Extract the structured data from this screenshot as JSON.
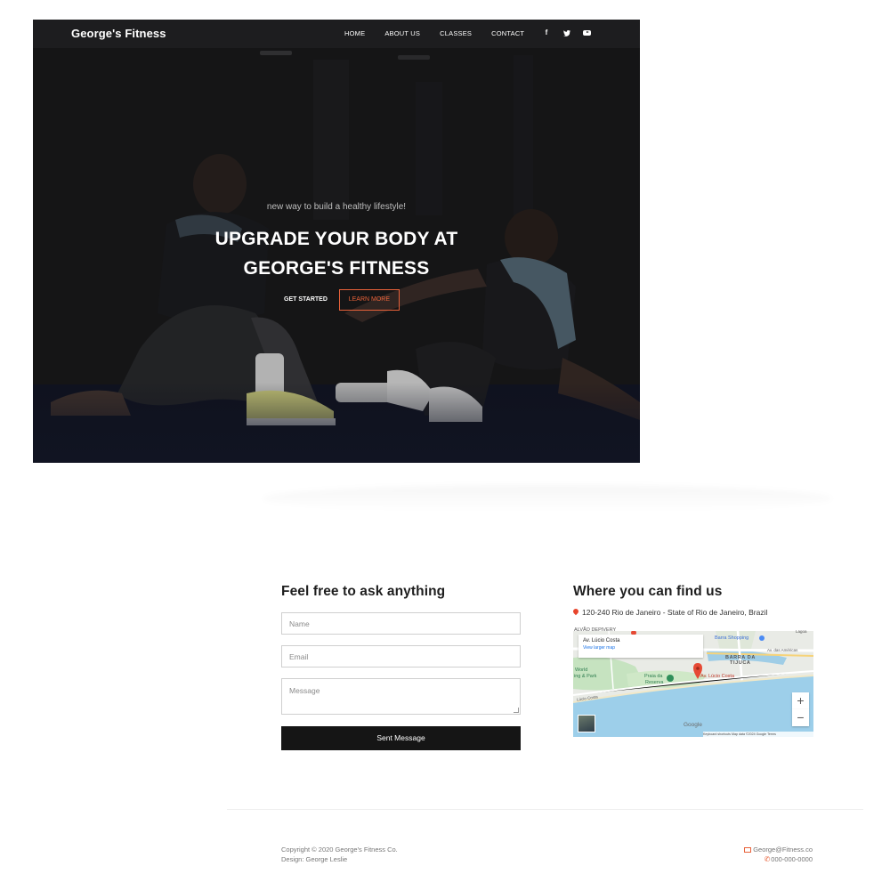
{
  "brand": "George's Fitness",
  "nav": {
    "links": [
      "HOME",
      "ABOUT US",
      "CLASSES",
      "CONTACT"
    ],
    "social": [
      "facebook-icon",
      "twitter-icon",
      "youtube-icon"
    ]
  },
  "hero": {
    "subtitle": "new way to build a healthy lifestyle!",
    "title_line1": "UPGRADE YOUR BODY AT",
    "title_line2": "GEORGE'S FITNESS",
    "cta_primary": "GET STARTED",
    "cta_secondary": "LEARN MORE"
  },
  "contact_form": {
    "title": "Feel free to ask anything",
    "name_placeholder": "Name",
    "email_placeholder": "Email",
    "message_placeholder": "Message",
    "submit_label": "Sent Message"
  },
  "location": {
    "title": "Where you can find us",
    "address": "120-240 Rio de Janeiro - State of Rio de Janeiro, Brazil",
    "map": {
      "card_title": "Av. Lúcio Costa",
      "card_link": "View larger map",
      "zoom_in": "+",
      "zoom_out": "−",
      "labels": {
        "top": "ALVÃO DEPIVERY",
        "mall": "Barra Shopping",
        "avenue": "Av. das Américas",
        "barra": "BARRA DA",
        "tijuca": "TIJUCA",
        "park": "World",
        "park2": "ing & Park",
        "praia": "Praia da",
        "reserva": "Reserva",
        "pin": "Av. Lúcio Costa",
        "road": "Lúcio Costa",
        "lagoa": "Lagoa"
      },
      "google": "Google",
      "footer": "Keyboard shortcuts    Map data ©2024 Google    Terms"
    }
  },
  "footer": {
    "copyright": "Copyright © 2020 George's Fitness Co.",
    "design": "Design: George Leslie",
    "email": "George@Fitness.co",
    "phone": "000-000-0000"
  },
  "colors": {
    "accent": "#e8623a",
    "nav_bg": "#1d1d1f",
    "button_dark": "#151515"
  }
}
